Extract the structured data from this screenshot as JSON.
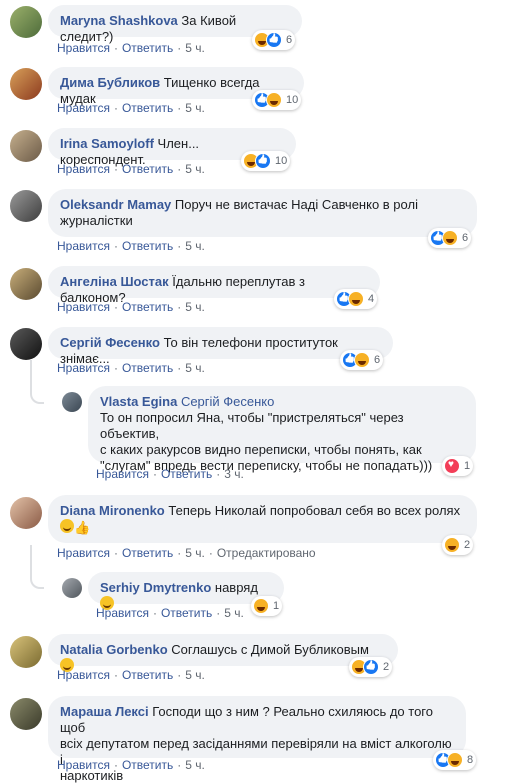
{
  "labels": {
    "like": "Нравится",
    "reply": "Ответить",
    "edited": "Отредактировано"
  },
  "comments": [
    {
      "name": "Maryna Shashkova",
      "text": "За Кивой следит?)",
      "time": "5 ч.",
      "count": "6"
    },
    {
      "name": "Дима Бубликов",
      "text": "Тищенко всегда мудак",
      "time": "5 ч.",
      "count": "10"
    },
    {
      "name": "Irina Samoyloff",
      "text": "Член... кореспондент.",
      "time": "5 ч.",
      "count": "10"
    },
    {
      "name": "Oleksandr Mamay",
      "text": "Поруч не вистачає Наді Савченко в ролі",
      "text2": "журналістки",
      "time": "5 ч.",
      "count": "6"
    },
    {
      "name": "Ангеліна Шостак",
      "text": "Їдальню переплутав з балконом?",
      "time": "5 ч.",
      "count": "4"
    },
    {
      "name": "Сергій Фесенко",
      "text": "То він телефони проституток знімає...",
      "time": "5 ч.",
      "count": "6"
    },
    {
      "name": "Vlasta Egina",
      "mention": "Сергій Фесенко",
      "line1": "То он попросил Яна, чтобы \"пристреляться\" через объектив,",
      "line2": "с каких ракурсов видно переписки, чтобы понять, как",
      "line3": "\"слугам\" впредь вести переписку, чтобы не попадать)))",
      "time": "3 ч.",
      "count": "1"
    },
    {
      "name": "Diana Mironenko",
      "text": "Теперь Николай попробовал себя во всех ролях",
      "time": "5 ч.",
      "count": "2"
    },
    {
      "name": "Serhiy Dmytrenko",
      "text": "навряд",
      "time": "5 ч.",
      "count": "1"
    },
    {
      "name": "Natalia Gorbenko",
      "text": "Соглашусь с Димой Бубликовым",
      "time": "5 ч.",
      "count": "2"
    },
    {
      "name": "Мараша Лексі",
      "text": "Господи що з ним ? Реально схиляюсь до того щоб",
      "text2": "всіх депутатом перед засіданнями перевіряли на вміст алкоголю і",
      "text3": "наркотиків",
      "time": "5 ч.",
      "count": "8"
    }
  ]
}
